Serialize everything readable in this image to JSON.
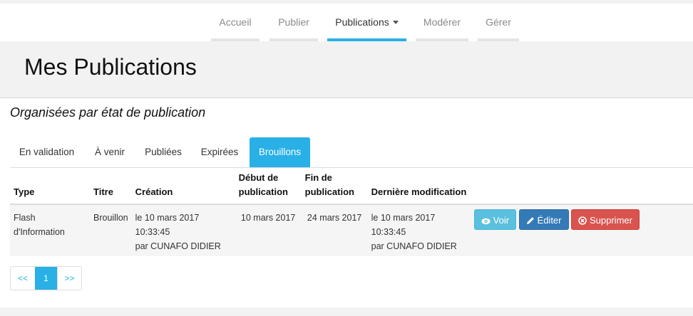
{
  "nav": {
    "items": [
      {
        "label": "Accueil"
      },
      {
        "label": "Publier"
      },
      {
        "label": "Publications"
      },
      {
        "label": "Modérer"
      },
      {
        "label": "Gérer"
      }
    ]
  },
  "page": {
    "title": "Mes Publications",
    "subtitle": "Organisées par état de publication"
  },
  "tabs": [
    {
      "label": "En validation"
    },
    {
      "label": "À venir"
    },
    {
      "label": "Publiées"
    },
    {
      "label": "Expirées"
    },
    {
      "label": "Brouillons"
    }
  ],
  "table": {
    "headers": {
      "type": "Type",
      "titre": "Titre",
      "creation": "Création",
      "debut_line1": "Début de",
      "debut_line2": "publication",
      "fin_line1": "Fin de",
      "fin_line2": "publication",
      "modif": "Dernière modification"
    },
    "rows": [
      {
        "type": "Flash d'Information",
        "titre": "Brouillon",
        "creation_line1": "le 10 mars 2017 10:33:45",
        "creation_line2": "par CUNAFO DIDIER",
        "debut": "10 mars 2017",
        "fin": "24 mars 2017",
        "modif_line1": "le 10 mars 2017 10:33:45",
        "modif_line2": "par CUNAFO DIDIER"
      }
    ],
    "actions": {
      "view": "Voir",
      "edit": "Éditer",
      "delete": "Supprimer"
    }
  },
  "pagination": {
    "prev": "<<",
    "current": "1",
    "next": ">>"
  },
  "colors": {
    "accent": "#29b0e6",
    "view": "#5bc0de",
    "edit": "#337ab7",
    "delete": "#d9534f"
  }
}
